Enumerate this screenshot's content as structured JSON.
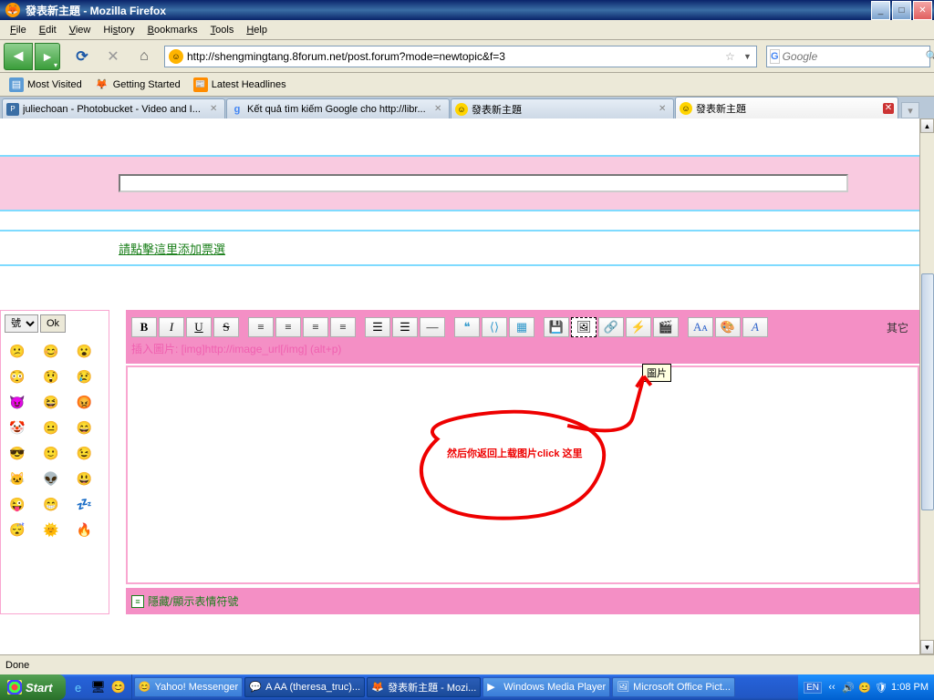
{
  "titlebar": {
    "text": "發表新主題 - Mozilla Firefox"
  },
  "menu": {
    "file": "File",
    "edit": "Edit",
    "view": "View",
    "history": "History",
    "bookmarks": "Bookmarks",
    "tools": "Tools",
    "help": "Help"
  },
  "nav": {
    "url": "http://shengmingtang.8forum.net/post.forum?mode=newtopic&f=3",
    "search_placeholder": "Google"
  },
  "bookmarks": {
    "most_visited": "Most Visited",
    "getting_started": "Getting Started",
    "latest_headlines": "Latest Headlines"
  },
  "tabs": {
    "t1": "juliechoan - Photobucket - Video and I...",
    "t2": "Kết quả tìm kiếm Google cho http://libr...",
    "t3": "發表新主題",
    "t4": "發表新主題"
  },
  "page": {
    "poll_link": "請點擊這里添加票選",
    "hint": "插入圖片: [img]http://image_url[/img] (alt+p)",
    "tooltip": "圖片",
    "annotation": "然后你返回上载图片click  这里",
    "footer_link": "隱藏/顯示表情符號",
    "other_btn": "其它"
  },
  "emoji": {
    "select": "號",
    "ok": "Ok"
  },
  "toolbar": {
    "b": "B",
    "i": "I",
    "u": "U",
    "s": "S"
  },
  "status": {
    "text": "Done"
  },
  "taskbar": {
    "start": "Start",
    "items": {
      "yahoo": "Yahoo! Messenger",
      "aaa": "A AA (theresa_truc)...",
      "ff": "發表新主題 - Mozi...",
      "wmp": "Windows Media Player",
      "mso": "Microsoft Office Pict..."
    },
    "lang": "EN",
    "time": "1:08 PM"
  }
}
